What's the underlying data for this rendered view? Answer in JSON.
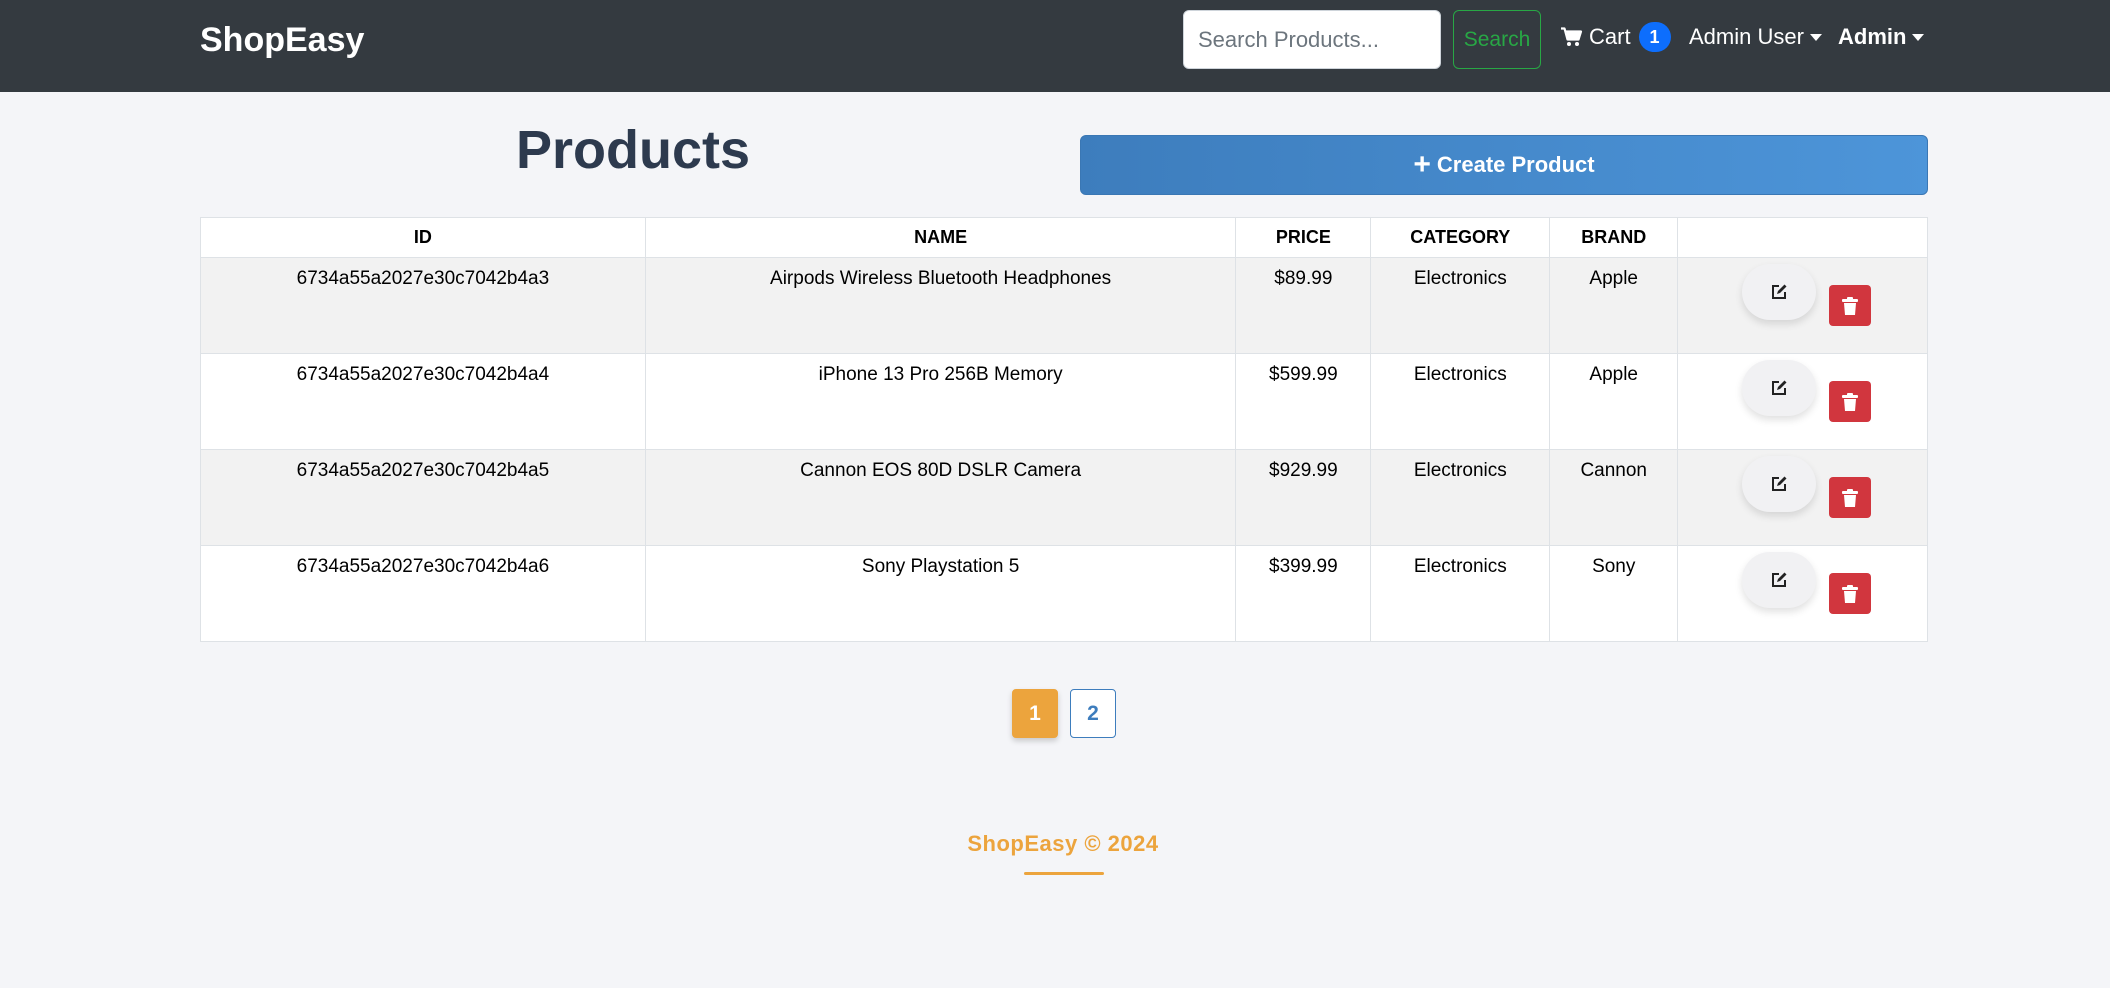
{
  "navbar": {
    "brand": "ShopEasy",
    "search_placeholder": "Search Products...",
    "search_button": "Search",
    "cart_label": "Cart",
    "cart_count": "1",
    "user_menu": "Admin User",
    "admin_menu": "Admin"
  },
  "header": {
    "title": "Products",
    "create_button": "Create Product"
  },
  "table": {
    "columns": [
      "ID",
      "NAME",
      "PRICE",
      "CATEGORY",
      "BRAND",
      ""
    ],
    "rows": [
      {
        "id": "6734a55a2027e30c7042b4a3",
        "name": "Airpods Wireless Bluetooth Headphones",
        "price": "$89.99",
        "category": "Electronics",
        "brand": "Apple"
      },
      {
        "id": "6734a55a2027e30c7042b4a4",
        "name": "iPhone 13 Pro 256B Memory",
        "price": "$599.99",
        "category": "Electronics",
        "brand": "Apple"
      },
      {
        "id": "6734a55a2027e30c7042b4a5",
        "name": "Cannon EOS 80D DSLR Camera",
        "price": "$929.99",
        "category": "Electronics",
        "brand": "Cannon"
      },
      {
        "id": "6734a55a2027e30c7042b4a6",
        "name": "Sony Playstation 5",
        "price": "$399.99",
        "category": "Electronics",
        "brand": "Sony"
      }
    ]
  },
  "pagination": {
    "pages": [
      "1",
      "2"
    ],
    "active": "1"
  },
  "footer": {
    "text": "ShopEasy © 2024"
  },
  "icons": {
    "cart": "cart-icon",
    "create": "plus-icon",
    "edit": "edit-icon",
    "delete": "trash-icon"
  },
  "colors": {
    "navbar_bg": "#343a40",
    "primary": "#3d7dbd",
    "accent": "#eca43d",
    "danger": "#d1363e",
    "success": "#28a745",
    "badge": "#0d6efd"
  }
}
